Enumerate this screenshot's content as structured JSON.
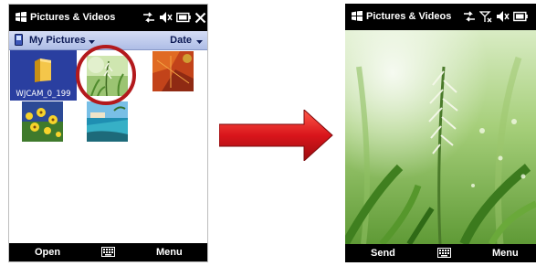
{
  "left_screen": {
    "title": "Pictures & Videos",
    "folder": "My Pictures",
    "sort": "Date",
    "folder_tile_label": "WJCAM_0_199",
    "thumbnails": [
      {
        "name": "grass-photo",
        "selected_highlight": true
      },
      {
        "name": "autumn-leaf-photo"
      },
      {
        "name": "yellow-flowers-photo"
      },
      {
        "name": "beach-resort-photo"
      }
    ],
    "softkeys": {
      "left": "Open",
      "right": "Menu"
    }
  },
  "right_screen": {
    "title": "Pictures & Videos",
    "softkeys": {
      "left": "Send",
      "right": "Menu"
    }
  },
  "colors": {
    "highlight_circle": "#b3191c",
    "arrow": "#d9151b",
    "folder_tile": "#2a3fa0",
    "titlebar": "#000000"
  }
}
